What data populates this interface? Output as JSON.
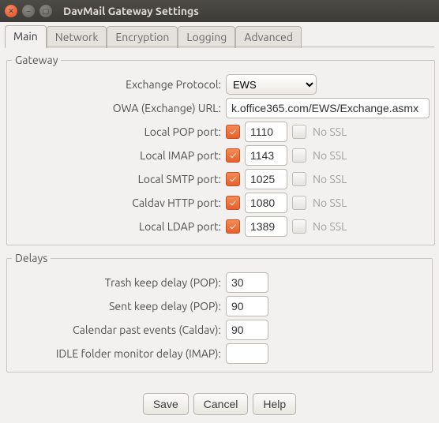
{
  "window": {
    "title": "DavMail Gateway Settings"
  },
  "tabs": {
    "main": "Main",
    "network": "Network",
    "encryption": "Encryption",
    "logging": "Logging",
    "advanced": "Advanced"
  },
  "gateway": {
    "legend": "Gateway",
    "exchange_protocol_label": "Exchange Protocol:",
    "exchange_protocol_value": "EWS",
    "owa_url_label": "OWA (Exchange) URL:",
    "owa_url_value": "k.office365.com/EWS/Exchange.asmx",
    "nossl_label": "No SSL",
    "ports": {
      "pop": {
        "label": "Local POP port:",
        "enabled": true,
        "value": "1110",
        "ssl_enabled": false
      },
      "imap": {
        "label": "Local IMAP port:",
        "enabled": true,
        "value": "1143",
        "ssl_enabled": false
      },
      "smtp": {
        "label": "Local SMTP port:",
        "enabled": true,
        "value": "1025",
        "ssl_enabled": false
      },
      "caldav": {
        "label": "Caldav HTTP port:",
        "enabled": true,
        "value": "1080",
        "ssl_enabled": false
      },
      "ldap": {
        "label": "Local LDAP port:",
        "enabled": true,
        "value": "1389",
        "ssl_enabled": false
      }
    }
  },
  "delays": {
    "legend": "Delays",
    "trash": {
      "label": "Trash keep delay (POP):",
      "value": "30"
    },
    "sent": {
      "label": "Sent keep delay (POP):",
      "value": "90"
    },
    "calpast": {
      "label": "Calendar past events (Caldav):",
      "value": "90"
    },
    "idle": {
      "label": "IDLE folder monitor delay (IMAP):",
      "value": ""
    }
  },
  "buttons": {
    "save": "Save",
    "cancel": "Cancel",
    "help": "Help"
  }
}
